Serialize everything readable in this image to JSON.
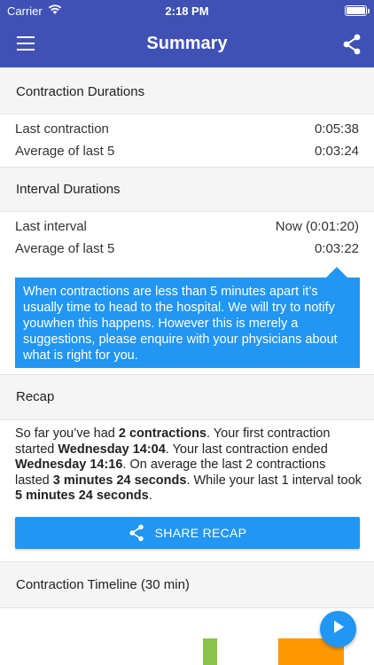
{
  "status_bar": {
    "carrier": "Carrier",
    "time": "2:18 PM",
    "battery_level": 0.9
  },
  "app_bar": {
    "title": "Summary",
    "menu_icon": "menu-icon",
    "share_icon": "share-icon"
  },
  "contraction_durations": {
    "header": "Contraction Durations",
    "rows": [
      {
        "label": "Last contraction",
        "value": "0:05:38"
      },
      {
        "label": "Average of last 5",
        "value": "0:03:24"
      }
    ]
  },
  "interval_durations": {
    "header": "Interval Durations",
    "rows": [
      {
        "label": "Last interval",
        "value": "Now (0:01:20)"
      },
      {
        "label": "Average of last 5",
        "value": "0:03:22"
      }
    ]
  },
  "tip": {
    "text": "When contractions are less than 5 minutes apart it’s usually time to head to the hospital. We will try to notify youwhen this happens. However this is merely a suggestions, please enquire with your physicians about what is right for you."
  },
  "recap": {
    "header": "Recap",
    "t1": "So far you’ve had ",
    "b1": "2 contractions",
    "t2": ". Your first contraction started ",
    "b2": "Wednesday 14:04",
    "t3": ". Your last contraction ended ",
    "b3": "Wednesday 14:16",
    "t4": ". On average the last 2 contractions lasted ",
    "b4": "3 minutes 24 seconds",
    "t5": ". While your last 1 interval took ",
    "b5": "5 minutes 24 seconds",
    "t6": ".",
    "share_button": "SHARE RECAP"
  },
  "timeline": {
    "header": "Contraction Timeline (30 min)"
  },
  "colors": {
    "primary": "#3f51b5",
    "accent": "#2196f3",
    "bar_green": "#8bc34a",
    "bar_orange": "#ff9800"
  }
}
